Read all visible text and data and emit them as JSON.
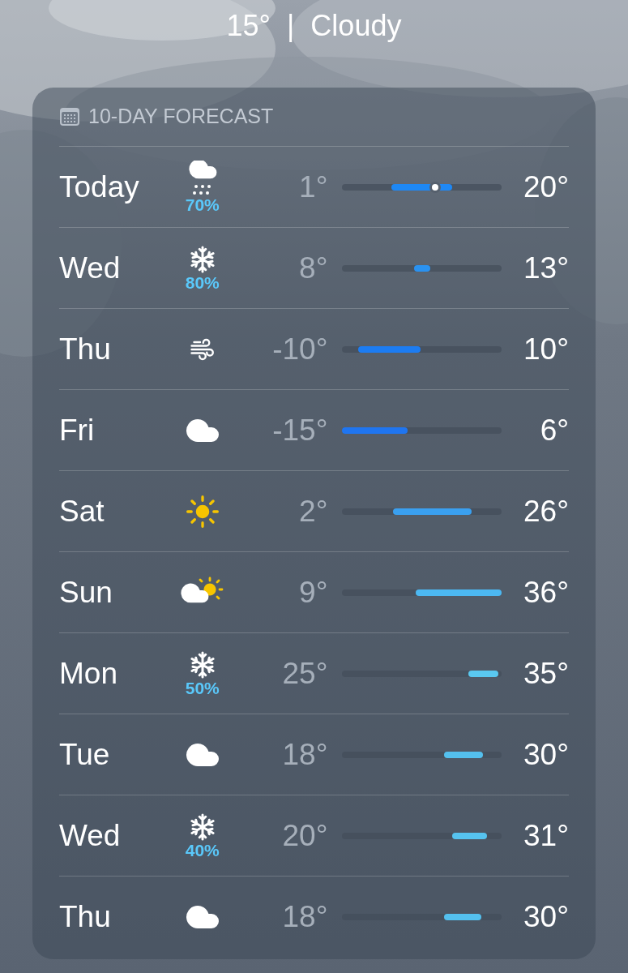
{
  "summary": "15°  |  Cloudy",
  "forecast": {
    "title": "10-DAY FORECAST",
    "days": [
      {
        "day": "Today",
        "kind": "snow_cloud",
        "precip": "70%",
        "low": "1°",
        "high": "20°",
        "color": "#1e88f5",
        "current_dot": {
          "level": 0.58
        }
      },
      {
        "day": "Wed",
        "kind": "snowflake",
        "precip": "80%",
        "low": "8°",
        "high": "13°",
        "color": "#2a92f0"
      },
      {
        "day": "Thu",
        "kind": "wind",
        "low": "-10°",
        "high": "10°",
        "color": "#1c7cf2"
      },
      {
        "day": "Fri",
        "kind": "cloud",
        "low": "-15°",
        "high": "6°",
        "color": "#1f75f0"
      },
      {
        "day": "Sat",
        "kind": "sun",
        "low": "2°",
        "high": "26°",
        "color": "#3aa0f0"
      },
      {
        "day": "Sun",
        "kind": "partly_sunny",
        "low": "9°",
        "high": "36°",
        "color": "#4cb8f2"
      },
      {
        "day": "Mon",
        "kind": "snowflake",
        "precip": "50%",
        "low": "25°",
        "high": "35°",
        "color": "#5ac8f0"
      },
      {
        "day": "Tue",
        "kind": "cloud",
        "low": "18°",
        "high": "30°",
        "color": "#54c0ee"
      },
      {
        "day": "Wed",
        "kind": "snowflake",
        "precip": "40%",
        "low": "20°",
        "high": "31°",
        "color": "#56c3ef"
      },
      {
        "day": "Thu",
        "kind": "cloud",
        "low": "18°",
        "high": "30°",
        "color": "#54c0ee"
      }
    ]
  }
}
